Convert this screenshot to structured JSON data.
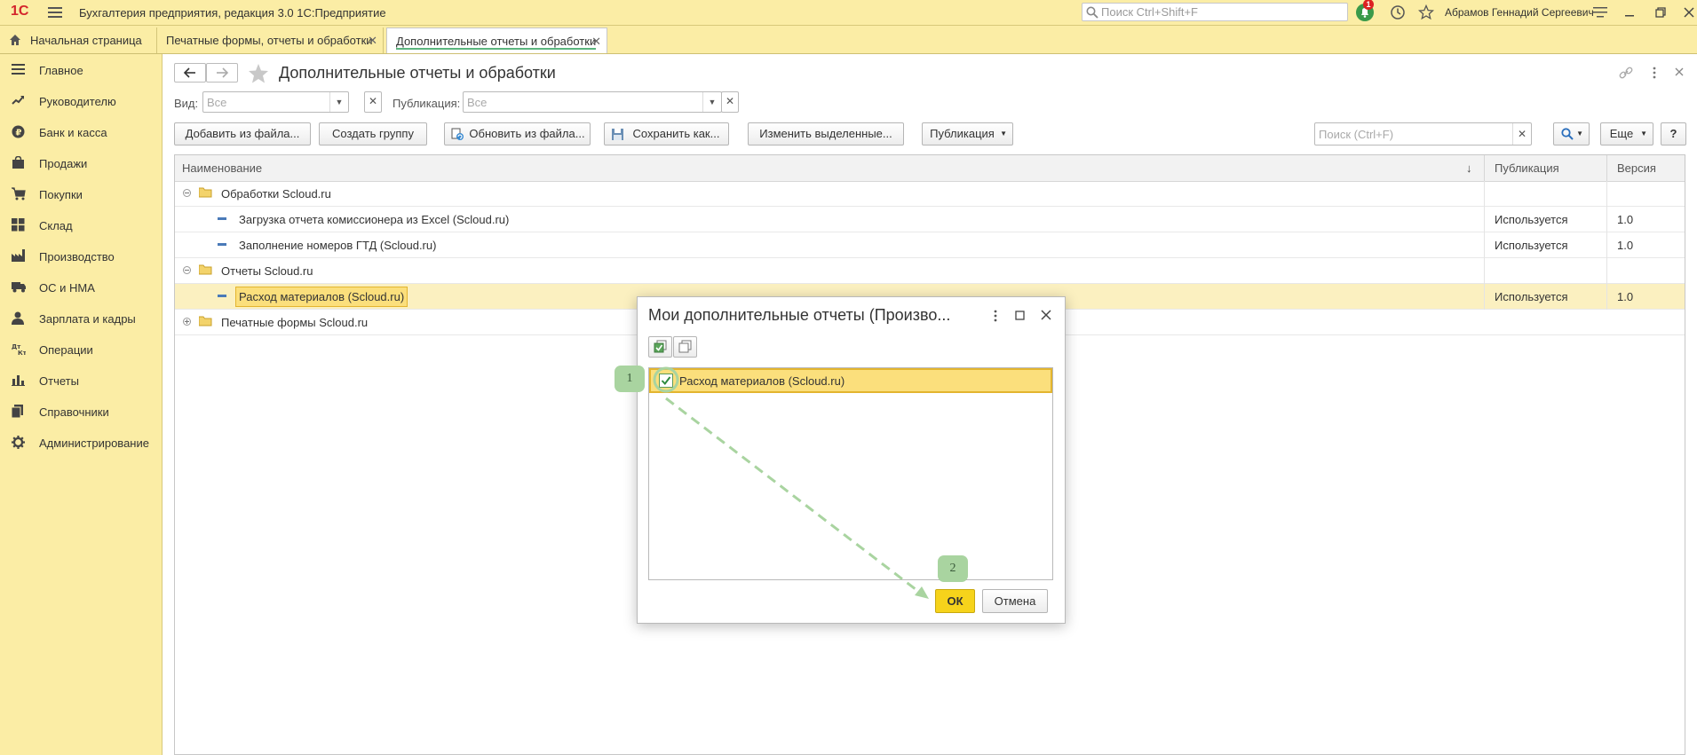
{
  "app": {
    "logo": "1С",
    "title": "Бухгалтерия предприятия, редакция 3.0 1С:Предприятие",
    "search_placeholder": "Поиск Ctrl+Shift+F",
    "notification_count": "1",
    "user": "Абрамов Геннадий Сергеевич"
  },
  "tabs": [
    {
      "label": "Начальная страница"
    },
    {
      "label": "Печатные формы, отчеты и обработки"
    },
    {
      "label": "Дополнительные отчеты и обработки"
    }
  ],
  "sidebar": {
    "items": [
      {
        "label": "Главное",
        "icon": "menu-lines-icon"
      },
      {
        "label": "Руководителю",
        "icon": "trend-icon"
      },
      {
        "label": "Банк и касса",
        "icon": "ruble-icon"
      },
      {
        "label": "Продажи",
        "icon": "bag-icon"
      },
      {
        "label": "Покупки",
        "icon": "cart-icon"
      },
      {
        "label": "Склад",
        "icon": "grid-icon"
      },
      {
        "label": "Производство",
        "icon": "factory-icon"
      },
      {
        "label": "ОС и НМА",
        "icon": "truck-icon"
      },
      {
        "label": "Зарплата и кадры",
        "icon": "person-icon"
      },
      {
        "label": "Операции",
        "icon": "dt-kt-icon"
      },
      {
        "label": "Отчеты",
        "icon": "bar-chart-icon"
      },
      {
        "label": "Справочники",
        "icon": "books-icon"
      },
      {
        "label": "Администрирование",
        "icon": "gear-icon"
      }
    ]
  },
  "page": {
    "title": "Дополнительные отчеты и обработки",
    "filter_view_label": "Вид:",
    "filter_view_value": "Все",
    "filter_publication_label": "Публикация:",
    "filter_publication_value": "Все",
    "buttons": {
      "add_from_file": "Добавить из файла...",
      "create_group": "Создать группу",
      "update_from_file": "Обновить из файла...",
      "save_as": "Сохранить как...",
      "change_selected": "Изменить выделенные...",
      "publication": "Публикация",
      "more": "Еще",
      "help": "?"
    },
    "search_placeholder": "Поиск (Ctrl+F)"
  },
  "grid": {
    "columns": [
      "Наименование",
      "Публикация",
      "Версия"
    ],
    "sort_indicator": "↓",
    "rows": [
      {
        "type": "group",
        "name": "Обработки Scloud.ru",
        "publication": "",
        "version": "",
        "expanded": true
      },
      {
        "type": "item",
        "name": "Загрузка отчета комиссионера из Excel (Scloud.ru)",
        "publication": "Используется",
        "version": "1.0"
      },
      {
        "type": "item",
        "name": "Заполнение номеров ГТД (Scloud.ru)",
        "publication": "Используется",
        "version": "1.0"
      },
      {
        "type": "group",
        "name": "Отчеты Scloud.ru",
        "publication": "",
        "version": "",
        "expanded": true
      },
      {
        "type": "item",
        "name": "Расход материалов (Scloud.ru)",
        "publication": "Используется",
        "version": "1.0",
        "selected": true
      },
      {
        "type": "group",
        "name": "Печатные формы Scloud.ru",
        "publication": "",
        "version": "",
        "expanded": false
      }
    ]
  },
  "dialog": {
    "title": "Мои дополнительные отчеты (Произво...",
    "items": [
      {
        "label": "Расход материалов (Scloud.ru)",
        "checked": true
      }
    ],
    "ok_label": "ОК",
    "cancel_label": "Отмена"
  },
  "annotations": {
    "marker1": "1",
    "marker2": "2"
  },
  "colors": {
    "panel": "#fbeda5",
    "selection": "#fbdf7c",
    "ok_button": "#f6d31b",
    "marker": "#a9d4a0"
  }
}
